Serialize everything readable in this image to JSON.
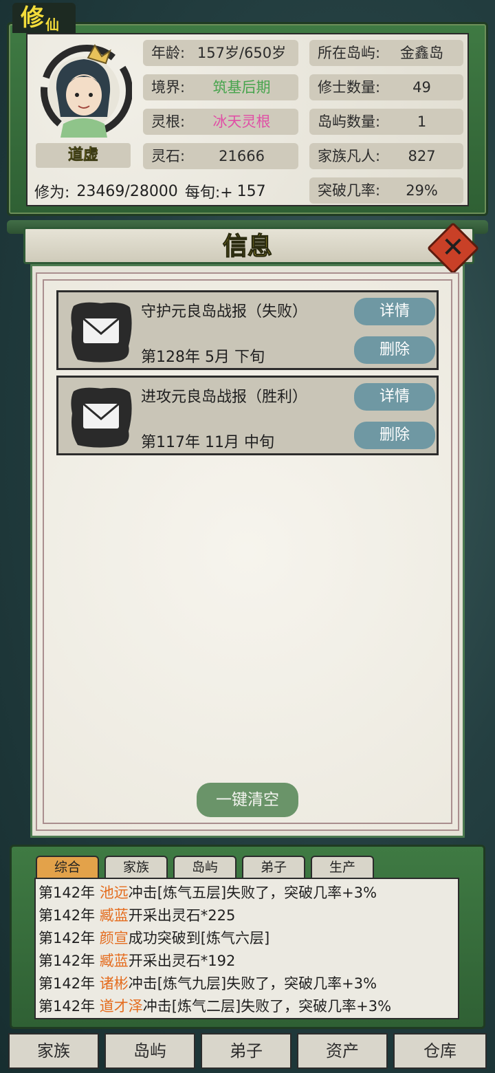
{
  "app": {
    "title_main": "修",
    "title_small": "仙"
  },
  "player": {
    "name": "道虚",
    "age": {
      "label": "年龄:",
      "value": "157岁/650岁"
    },
    "realm": {
      "label": "境界:",
      "value": "筑基后期"
    },
    "root": {
      "label": "灵根:",
      "value": "冰天灵根"
    },
    "stones": {
      "label": "灵石:",
      "value": "21666"
    },
    "island": {
      "label": "所在岛屿:",
      "value": "金鑫岛"
    },
    "cultivators": {
      "label": "修士数量:",
      "value": "49"
    },
    "islands": {
      "label": "岛屿数量:",
      "value": "1"
    },
    "mortals": {
      "label": "家族凡人:",
      "value": "827"
    },
    "cultivation": {
      "label": "修为:",
      "value": "23469/28000",
      "rate_label": "每旬:+",
      "rate_value": "157"
    },
    "breakthrough": {
      "label": "突破几率:",
      "value": "29%"
    }
  },
  "info": {
    "title": "信息",
    "messages": [
      {
        "title": "守护元良岛战报（失败）",
        "date": "第128年 5月 下旬",
        "detail": "详情",
        "delete": "删除"
      },
      {
        "title": "进攻元良岛战报（胜利）",
        "date": "第117年 11月 中旬",
        "detail": "详情",
        "delete": "删除"
      }
    ],
    "clear_all": "一键清空"
  },
  "log": {
    "tabs": [
      "综合",
      "家族",
      "岛屿",
      "弟子",
      "生产"
    ],
    "active_tab": "综合",
    "entries": [
      {
        "year": "第142年",
        "who": "池远",
        "text": "冲击[炼气五层]失败了，突破几率+3%"
      },
      {
        "year": "第142年",
        "who": "臧蓝",
        "text": "开采出灵石*225"
      },
      {
        "year": "第142年",
        "who": "颜宣",
        "text": "成功突破到[炼气六层]"
      },
      {
        "year": "第142年",
        "who": "臧蓝",
        "text": "开采出灵石*192"
      },
      {
        "year": "第142年",
        "who": "诸彬",
        "text": "冲击[炼气九层]失败了，突破几率+3%"
      },
      {
        "year": "第142年",
        "who": "道才泽",
        "text": "冲击[炼气二层]失败了，突破几率+3%"
      }
    ]
  },
  "nav": [
    "家族",
    "岛屿",
    "弟子",
    "资产",
    "仓库"
  ],
  "colors": {
    "accent_green": "#47a44d",
    "root_pink": "#e04fa6",
    "name_orange": "#e46c1e",
    "title_yellow": "#f3dc3a"
  },
  "icons": {
    "message": "envelope-icon",
    "close": "close-icon"
  }
}
